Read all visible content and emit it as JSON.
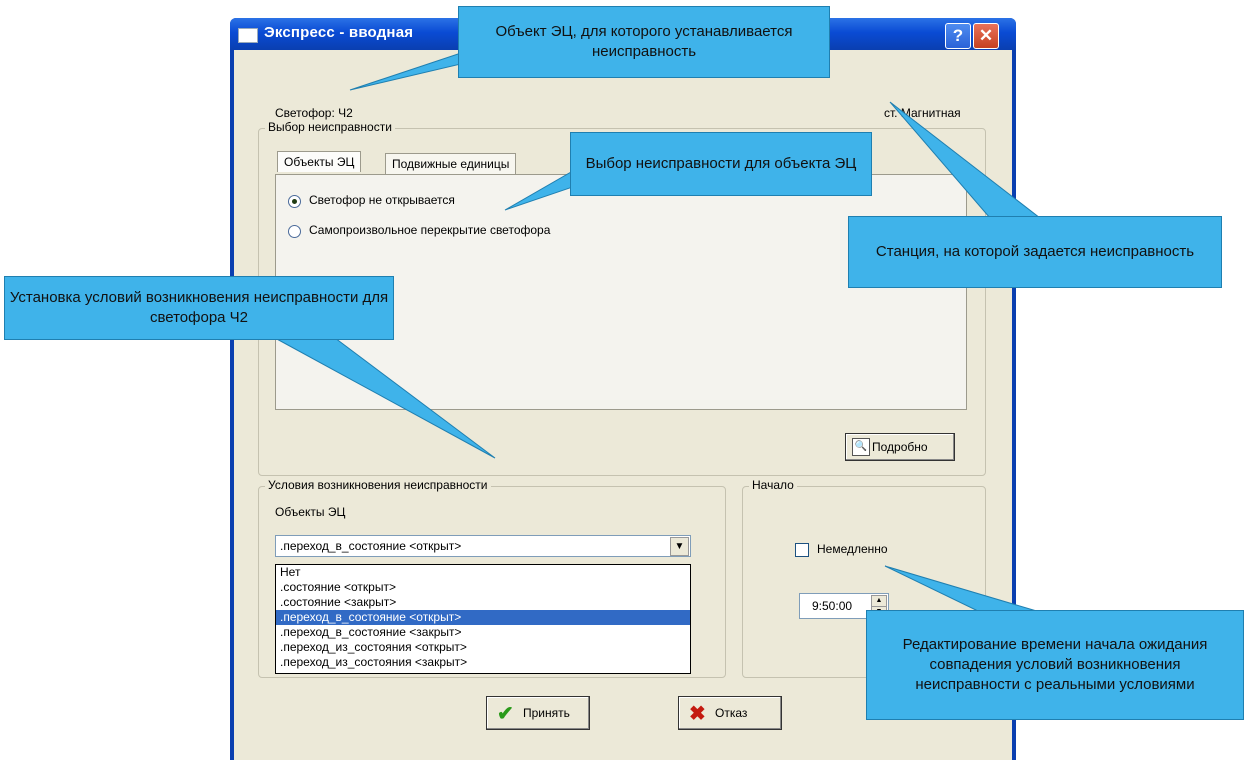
{
  "window": {
    "title": "Экспресс - вводная",
    "help_label": "?",
    "close_label": "✕"
  },
  "header": {
    "signal_label": "Светофор: Ч2",
    "station_label": "ст. Магнитная"
  },
  "fault_group": {
    "title": "Выбор неисправности",
    "tabs": [
      {
        "label": "Объекты ЭЦ",
        "active": true
      },
      {
        "label": "Подвижные единицы",
        "active": false
      }
    ],
    "options": [
      {
        "label": "Светофор не открывается",
        "checked": true
      },
      {
        "label": "Самопроизвольное перекрытие светофора",
        "checked": false
      }
    ],
    "details_button": "Подробно"
  },
  "conditions_group": {
    "title": "Условия возникновения неисправности",
    "objects_label": "Объекты ЭЦ",
    "combo_value": ".переход_в_состояние <открыт>",
    "list_items": [
      "Нет",
      ".состояние <открыт>",
      ".состояние <закрыт>",
      ".переход_в_состояние <открыт>",
      ".переход_в_состояние <закрыт>",
      ".переход_из_состояния <открыт>",
      ".переход_из_состояния <закрыт>"
    ],
    "selected_index": 3
  },
  "start_group": {
    "title": "Начало",
    "immediately_label": "Немедленно",
    "immediately_checked": false,
    "time_value": "9:50:00"
  },
  "buttons": {
    "accept_label": "Принять",
    "cancel_label": "Отказ"
  },
  "callouts": {
    "object": "Объект ЭЦ, для которого устанавливается неисправность",
    "fault_choice": "Выбор неисправности для объекта ЭЦ",
    "station": "Станция, на которой задается неисправность",
    "conditions": "Установка условий возникновения неисправности для светофора Ч2",
    "time_edit": "Редактирование времени начала ожидания совпадения условий возникновения неисправности с реальными условиями"
  }
}
